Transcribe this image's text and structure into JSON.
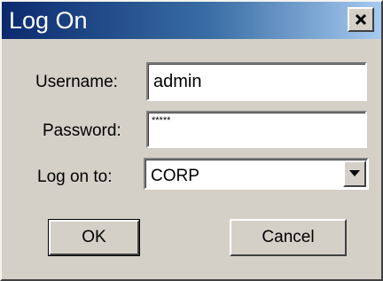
{
  "window": {
    "title": "Log On",
    "close_icon": "close-icon"
  },
  "form": {
    "username_label": "Username:",
    "username_value": "admin",
    "password_label": "Password:",
    "password_mask": "*****",
    "logon_to_label": "Log on to:",
    "logon_to_value": "CORP",
    "dropdown_icon": "chevron-down-icon"
  },
  "buttons": {
    "ok_label": "OK",
    "cancel_label": "Cancel"
  },
  "colors": {
    "titlebar_start": "#0b2a6e",
    "titlebar_end": "#a6caf0",
    "dialog_face": "#d4d0c8"
  }
}
